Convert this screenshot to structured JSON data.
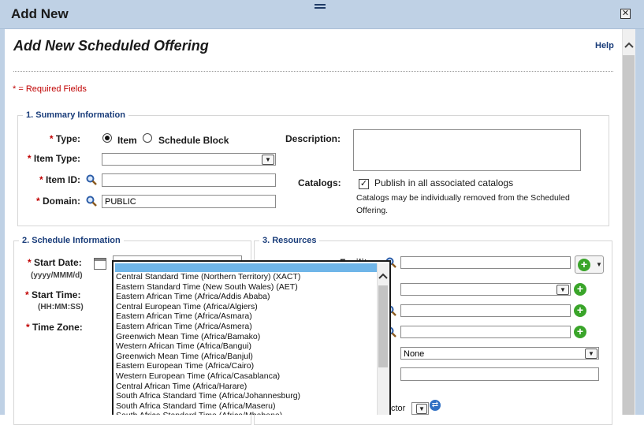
{
  "modal": {
    "title": "Add New",
    "close_symbol": "✕"
  },
  "page": {
    "title": "Add New Scheduled Offering",
    "help_label": "Help",
    "required_note": "* = Required Fields"
  },
  "summary": {
    "legend": "1. Summary Information",
    "type_label": "Type:",
    "type_options": [
      {
        "label": "Item",
        "selected": true
      },
      {
        "label": "Schedule Block",
        "selected": false
      }
    ],
    "item_type_label": "Item Type:",
    "item_type_value": "",
    "item_id_label": "Item ID:",
    "item_id_value": "",
    "domain_label": "Domain:",
    "domain_value": "PUBLIC",
    "description_label": "Description:",
    "description_value": "",
    "catalogs_label": "Catalogs:",
    "catalogs_checkbox_label": "Publish in all associated catalogs",
    "catalogs_checked": true,
    "catalogs_note_line1": "Catalogs may be individually removed from the Scheduled",
    "catalogs_note_line2": "Offering."
  },
  "schedule": {
    "legend": "2. Schedule Information",
    "start_date_label": "Start Date:",
    "start_date_hint": "(yyyy/MMM/d)",
    "start_time_label": "Start Time:",
    "start_time_hint": "(HH:MM:SS)",
    "time_zone_label": "Time Zone:"
  },
  "resources": {
    "legend": "3. Resources",
    "facility_label_partial": "Facilit",
    "select_none_value": "None",
    "instructor_partial": "ctor"
  },
  "timezone_dropdown": {
    "highlighted_value": "",
    "options": [
      "Central Standard Time (Northern Territory) (XACT)",
      "Eastern Standard Time (New South Wales) (AET)",
      "Eastern African Time (Africa/Addis Ababa)",
      "Central European Time (Africa/Algiers)",
      "Eastern African Time (Africa/Asmara)",
      "Eastern African Time (Africa/Asmera)",
      "Greenwich Mean Time (Africa/Bamako)",
      "Western African Time (Africa/Bangui)",
      "Greenwich Mean Time (Africa/Banjul)",
      "Eastern European Time (Africa/Cairo)",
      "Western European Time (Africa/Casablanca)",
      "Central African Time (Africa/Harare)",
      "South Africa Standard Time (Africa/Johannesburg)",
      "South Africa Standard Time (Africa/Maseru)",
      "South Africa Standard Time (Africa/Mbabane)"
    ]
  },
  "icons": {
    "lookup": "magnifier-icon",
    "add": "add-icon",
    "refresh": "refresh-icon",
    "calendar": "calendar-icon"
  },
  "colors": {
    "header_bg": "#bfd1e5",
    "legend_text": "#1a3d7a",
    "required": "#c00000",
    "highlight": "#6fb5e8",
    "add_green": "#3aa52a"
  }
}
